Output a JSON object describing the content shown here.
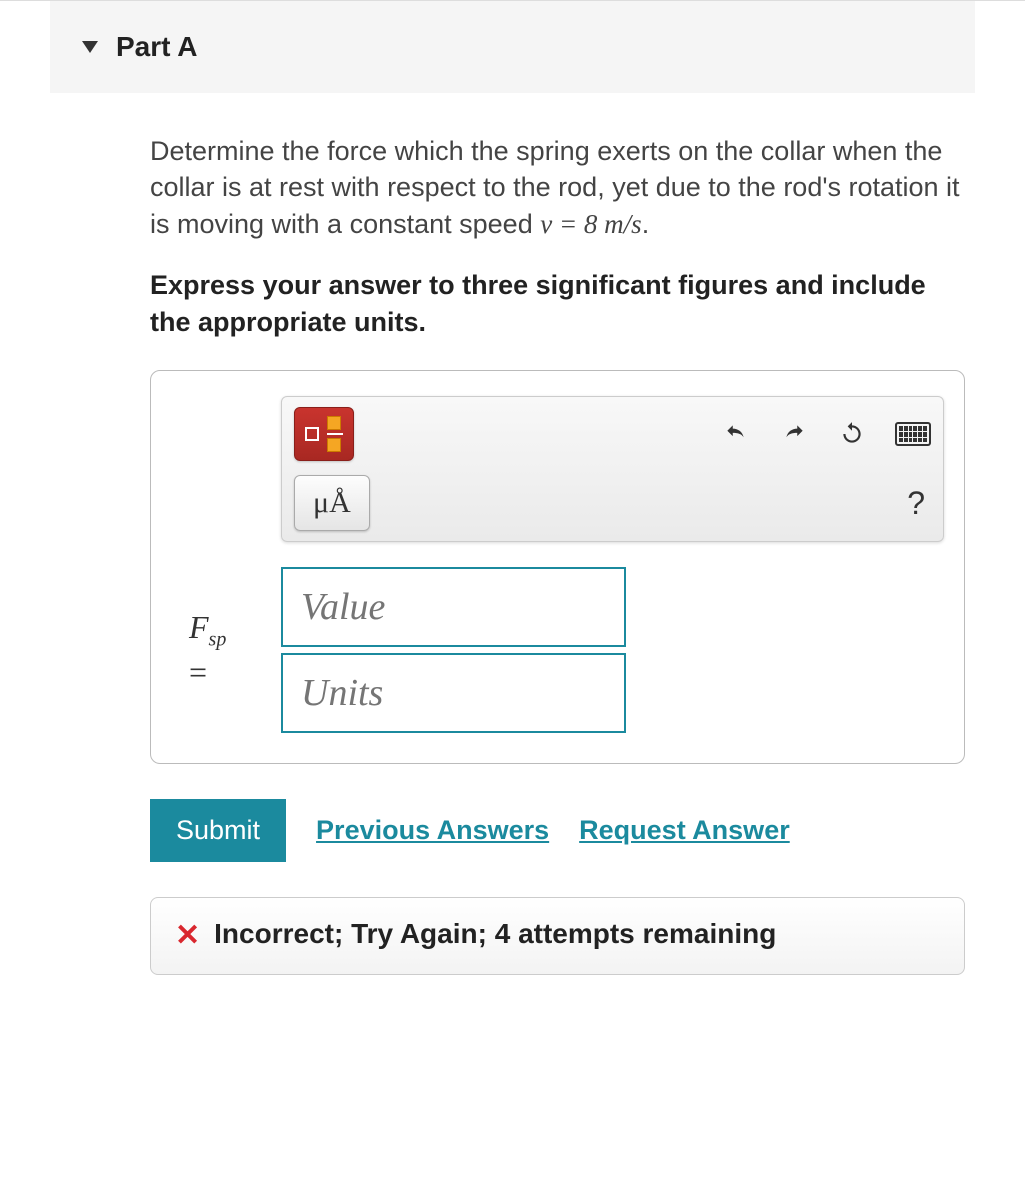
{
  "part": {
    "title": "Part A"
  },
  "question": {
    "text_before": "Determine the force which the spring exerts on the collar when the collar is at rest with respect to the rod, yet due to the rod's rotation it is moving with a constant speed ",
    "equation": "v = 8 m/s",
    "period": "."
  },
  "instruction": "Express your answer to three significant figures and include the appropriate units.",
  "toolbar": {
    "units_label": "μÅ",
    "help_label": "?"
  },
  "answer": {
    "variable": "F",
    "subscript": "sp",
    "equals": "=",
    "value_placeholder": "Value",
    "units_placeholder": "Units"
  },
  "actions": {
    "submit": "Submit",
    "previous": "Previous Answers",
    "request": "Request Answer"
  },
  "feedback": {
    "icon": "✕",
    "message": "Incorrect; Try Again; 4 attempts remaining"
  }
}
